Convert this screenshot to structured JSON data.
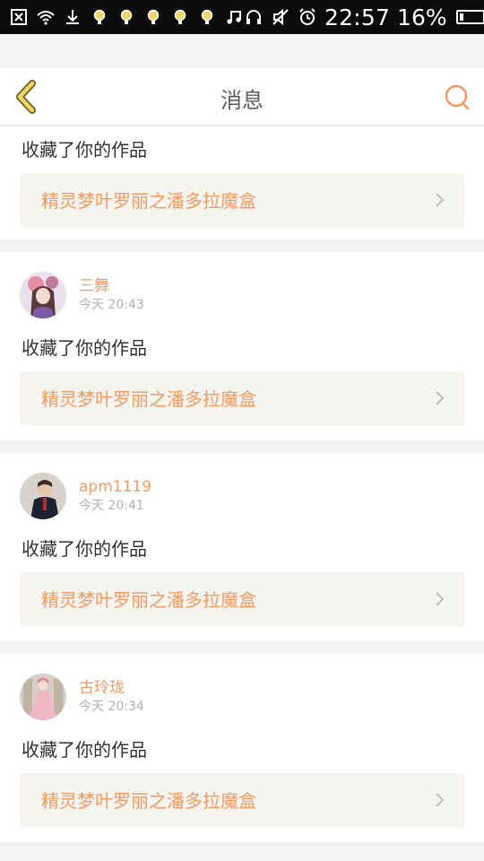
{
  "status_bar": {
    "time": "22:57",
    "battery_pct": "16%",
    "battery_level": 0.16,
    "left_icons": [
      "close-box-icon",
      "wifi-icon",
      "download-icon",
      "bulb-icon",
      "bulb-icon",
      "bulb-icon",
      "bulb-icon",
      "bulb-icon",
      "music-note-icon"
    ],
    "right_icons": [
      "headphones-icon",
      "mute-icon",
      "alarm-icon"
    ]
  },
  "header": {
    "title": "消息",
    "back_icon": "chevron-left-icon",
    "search_icon": "search-icon",
    "accent_color": "#f39a64"
  },
  "items": [
    {
      "partial": true,
      "action": "收藏了你的作品",
      "work": "精灵梦叶罗丽之潘多拉魔盒"
    },
    {
      "user": "三舞",
      "time": "今天 20:43",
      "action": "收藏了你的作品",
      "work": "精灵梦叶罗丽之潘多拉魔盒",
      "avatar_icon": "avatar-anime-girl"
    },
    {
      "user": "apm1119",
      "time": "今天 20:41",
      "action": "收藏了你的作品",
      "work": "精灵梦叶罗丽之潘多拉魔盒",
      "avatar_icon": "avatar-man"
    },
    {
      "user": "古玲珑",
      "time": "今天 20:34",
      "action": "收藏了你的作品",
      "work": "精灵梦叶罗丽之潘多拉魔盒",
      "avatar_icon": "avatar-pink-dress"
    }
  ]
}
